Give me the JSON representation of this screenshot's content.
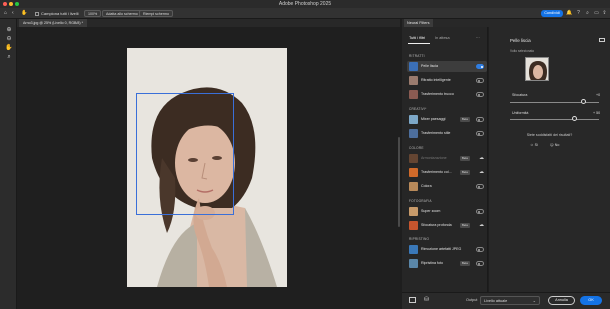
{
  "app": {
    "title": "Adobe Photoshop 2025"
  },
  "options_bar": {
    "sample_all_layers": "Campiona tutti i livelli",
    "zoom": "100%",
    "fit_screen": "Adatta allo schermo",
    "fill_screen": "Riempi schermo",
    "share": "Condividi"
  },
  "document": {
    "tab_label": "Arno3.jpg @ 25% (Livello 0, RGB/8) *"
  },
  "neural": {
    "panel_tab": "Neural Filters",
    "tabs": {
      "all": "Tutti i filtri",
      "wait": "In attesa"
    },
    "sections": {
      "portraits": "RITRATTI",
      "creative": "CREATIVI*",
      "color": "COLORE",
      "photography": "FOTOGRAFIA",
      "restore": "RIPRISTINO"
    },
    "filters": [
      {
        "label": "Pelle liscia",
        "badge": "",
        "state": "toggle-on",
        "dim": false
      },
      {
        "label": "Ritratto intelligente",
        "badge": "",
        "state": "toggle-off",
        "dim": false
      },
      {
        "label": "Trasferimento trucco",
        "badge": "",
        "state": "toggle-off",
        "dim": false
      },
      {
        "label": "Mixer paesaggi",
        "badge": "Beta",
        "state": "toggle-off",
        "dim": false
      },
      {
        "label": "Trasferimento stile",
        "badge": "",
        "state": "toggle-off",
        "dim": false
      },
      {
        "label": "Armonizzazione",
        "badge": "Beta",
        "state": "download",
        "dim": true
      },
      {
        "label": "Trasferimento col...",
        "badge": "Beta",
        "state": "download",
        "dim": false
      },
      {
        "label": "Colora",
        "badge": "",
        "state": "toggle-off",
        "dim": false
      },
      {
        "label": "Super zoom",
        "badge": "",
        "state": "toggle-off",
        "dim": false
      },
      {
        "label": "Sfocatura profonda",
        "badge": "Beta",
        "state": "download",
        "dim": false
      },
      {
        "label": "Rimozione artefatti JPEG",
        "badge": "",
        "state": "toggle-off",
        "dim": false
      },
      {
        "label": "Ripristina foto",
        "badge": "Beta",
        "state": "toggle-off",
        "dim": false
      }
    ]
  },
  "detail": {
    "title": "Pelle liscia",
    "selected_face_label": "Volto selezionato",
    "sliders": [
      {
        "label": "Sfocatura",
        "value": "+0",
        "level": 0.83
      },
      {
        "label": "Uniformità",
        "value": "+ 50",
        "level": 0.73
      }
    ],
    "feedback": {
      "question": "Siete soddisfatti dei risultati?",
      "yes": "Sì",
      "no": "No"
    }
  },
  "bottom": {
    "output_label": "Output",
    "output_value": "Livello attuale",
    "cancel": "Annulla",
    "ok": "OK"
  },
  "colors": {
    "accent": "#1473e6",
    "selection": "#3a6fd8"
  }
}
